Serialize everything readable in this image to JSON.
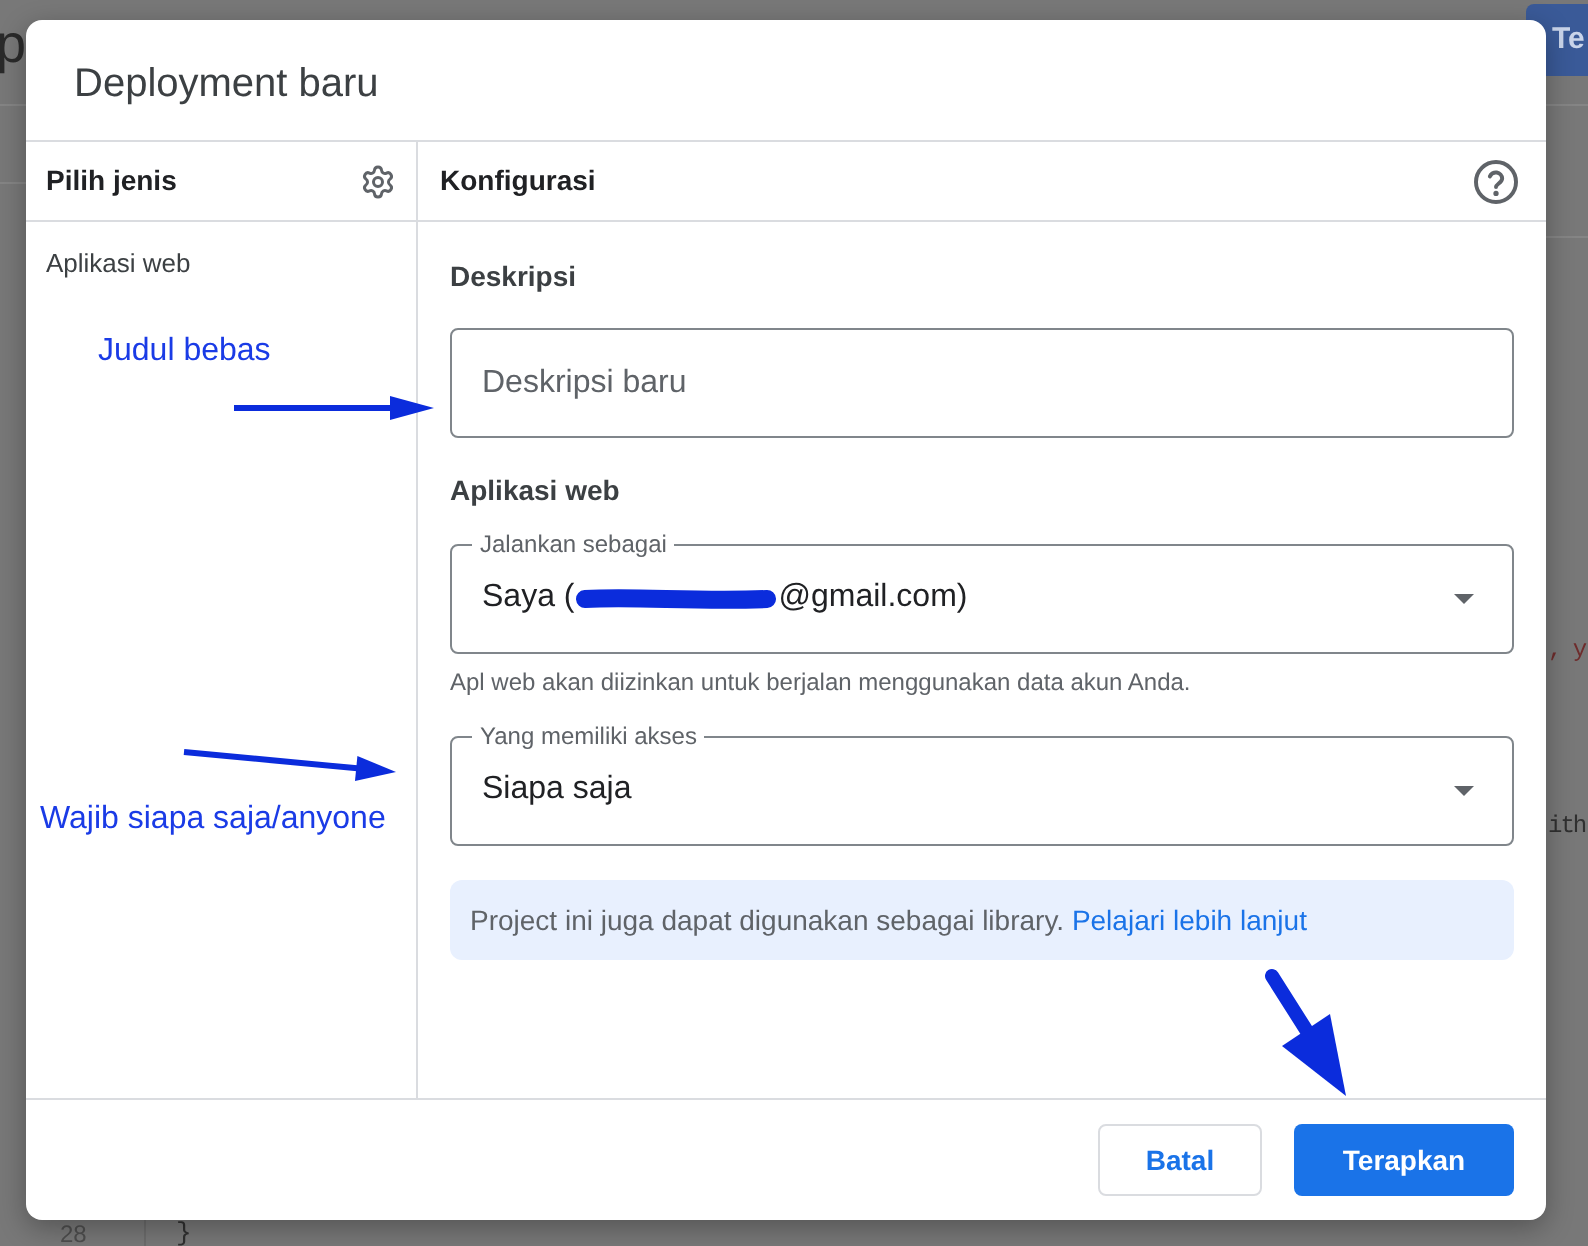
{
  "backdrop": {
    "page_title": "p",
    "top_button": "Te",
    "code_fragments": [
      {
        "text": ", y",
        "color": "#6e2c2c"
      },
      {
        "text": "ith",
        "color": "#303030"
      }
    ],
    "line_number": "28",
    "code_brace": "}"
  },
  "dialog": {
    "title": "Deployment baru",
    "type_panel": {
      "heading": "Pilih jenis",
      "items": [
        {
          "label": "Aplikasi web"
        }
      ]
    },
    "config_panel": {
      "heading": "Konfigurasi",
      "sections": [
        {
          "heading": "Deskripsi",
          "fields": [
            {
              "kind": "text",
              "placeholder": "Deskripsi baru"
            }
          ]
        },
        {
          "heading": "Aplikasi web",
          "fields": [
            {
              "kind": "select",
              "label": "Jalankan sebagai",
              "value_parts": [
                "Saya (",
                "@gmail.com)"
              ],
              "helper": "Apl web akan diizinkan untuk berjalan menggunakan data akun Anda."
            },
            {
              "kind": "select",
              "label": "Yang memiliki akses",
              "value_parts": [
                "Siapa saja"
              ]
            }
          ]
        }
      ],
      "info": {
        "text": "Project ini juga dapat digunakan sebagai library.",
        "link": "Pelajari lebih lanjut"
      }
    },
    "buttons": [
      {
        "label": "Batal",
        "kind": "secondary"
      },
      {
        "label": "Terapkan",
        "kind": "primary"
      }
    ]
  },
  "annotations": {
    "labels": [
      "Judul bebas",
      "Wajib siapa saja/anyone"
    ]
  }
}
